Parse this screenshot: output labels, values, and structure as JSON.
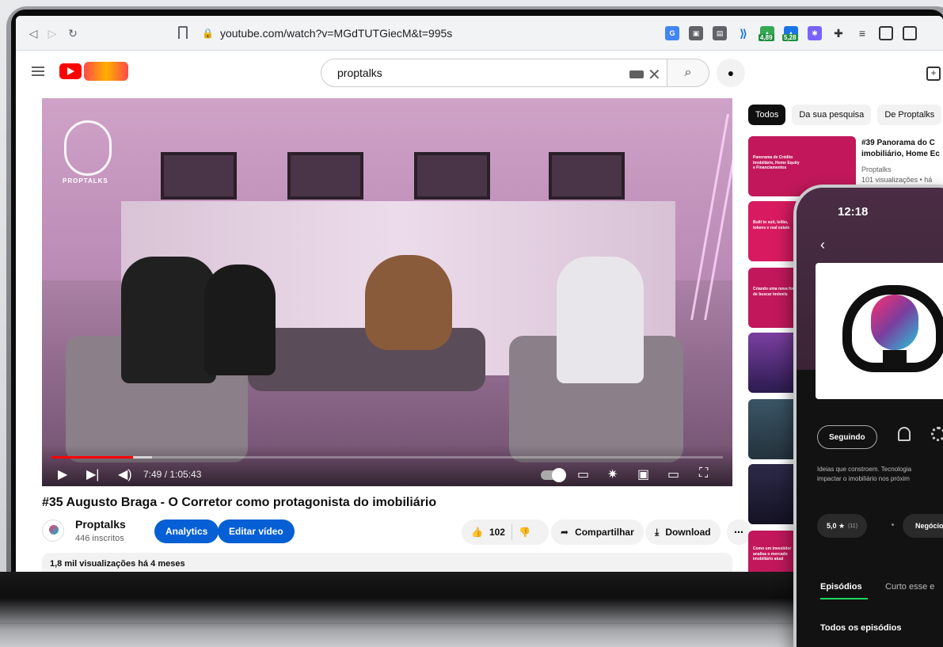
{
  "browser": {
    "url": "youtube.com/watch?v=MGdTUTGiecM&t=995s",
    "extension_badges": [
      "4,89",
      "5,28"
    ]
  },
  "youtube": {
    "search_query": "proptalks",
    "player": {
      "time": "7:49 / 1:05:43",
      "overlay_brand": "PROPTALKS",
      "progress_played_fraction": 0.121,
      "progress_loaded_fraction": 0.15
    },
    "video": {
      "title": "#35 Augusto Braga - O Corretor como protagonista do imobiliário",
      "channel_name": "Proptalks",
      "subscribers": "446 inscritos",
      "analytics_label": "Analytics",
      "edit_label": "Editar vídeo",
      "likes": "102",
      "share_label": "Compartilhar",
      "download_label": "Download",
      "more_label": "⋯",
      "description_meta": "1,8 mil visualizações  há 4 meses"
    },
    "chips": [
      "Todos",
      "Da sua pesquisa",
      "De Proptalks"
    ],
    "recommendations": [
      {
        "thumb_text": "Panorama de Crédito Imobiliário, Home Equity e Financiamentos",
        "thumb_color": "#c2185b",
        "title_line1": "#39 Panorama do C",
        "title_line2": "imobiliário, Home Ec",
        "channel": "Proptalks",
        "meta": "101 visualizações • há"
      },
      {
        "thumb_text": "Built to suit, leilão, tokens e real estate",
        "thumb_color": "#d81b60"
      },
      {
        "thumb_text": "Criando uma nova forma de buscar imóveis",
        "thumb_color": "#c2185b"
      },
      {
        "thumb_text": "",
        "thumb_color": "#5c2a7a"
      },
      {
        "thumb_text": "",
        "thumb_color": "#2f4a5a"
      },
      {
        "thumb_text": "",
        "thumb_color": "#2a2a44"
      },
      {
        "thumb_text": "Como um investidor analisa o mercado imobiliário atual",
        "thumb_color": "#c2185b"
      }
    ]
  },
  "phone": {
    "time": "12:18",
    "following_label": "Seguindo",
    "description": "Ideias que constroem. Tecnologia\nimpactar o imobiliário nos próxim",
    "rating": "5,0 ★",
    "rating_count": "(11)",
    "category": "Negócio",
    "tabs": [
      "Episódios",
      "Curto esse e"
    ],
    "section_title": "Todos os episódios",
    "accent_color": "#1ed760"
  }
}
